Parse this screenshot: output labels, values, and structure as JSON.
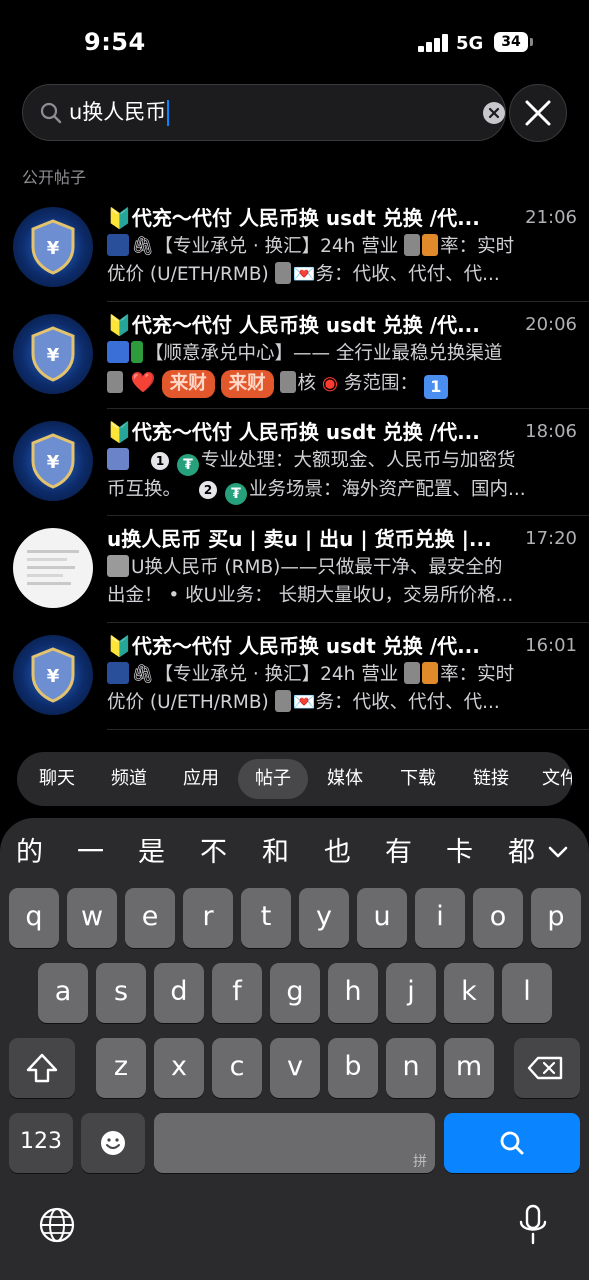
{
  "status_bar": {
    "time": "9:54",
    "network": "5G",
    "battery": "34"
  },
  "search": {
    "query": "u换人民币"
  },
  "section_label": "公开帖子",
  "results": [
    {
      "avatar": "shield-logo",
      "title": "🔰代充～代付 人民币换 usdt 兑换 /代...",
      "time": "21:06",
      "line1": "🖇【专业承兑 · 换汇】24h 营业 ",
      "line1b": "率：实时",
      "line2": "优价 (U/ETH/RMB) ",
      "line2b": "💌务：代收、代付、代..."
    },
    {
      "avatar": "shield-logo",
      "title": "🔰代充～代付 人民币换 usdt 兑换 /代...",
      "time": "20:06",
      "line1": "【顺意承兑中心】—— 全行业最稳兑换渠道",
      "line2a": "❤️",
      "red1": "来财",
      "red2": "来财",
      "line2b": "核",
      "line2c": "务范围：",
      "badge": "1"
    },
    {
      "avatar": "shield-logo",
      "title": "🔰代充～代付 人民币换 usdt 兑换 /代...",
      "time": "18:06",
      "num1": "1",
      "line1": "专业处理：大额现金、人民币与加密货",
      "line2a": "币互换。",
      "num2": "2",
      "line2b": "业务场景：海外资产配置、国内..."
    },
    {
      "avatar": "document",
      "title": "u换人民币 买u | 卖u | 出u | 货币兑换 |...",
      "time": "17:20",
      "line1": "U换人民币 (RMB)——只做最干净、最安全的",
      "line2": "出金！ • 收U业务： 长期大量收U，交易所价格..."
    },
    {
      "avatar": "shield-logo",
      "title": "🔰代充～代付 人民币换 usdt 兑换 /代...",
      "time": "16:01",
      "line1": "🖇【专业承兑 · 换汇】24h 营业 ",
      "line1b": "率：实时",
      "line2": "优价 (U/ETH/RMB) ",
      "line2b": "💌务：代收、代付、代..."
    }
  ],
  "filter_tabs": [
    "聊天",
    "频道",
    "应用",
    "帖子",
    "媒体",
    "下载",
    "链接",
    "文件"
  ],
  "active_tab": "帖子",
  "keyboard": {
    "candidates": [
      "的",
      "一",
      "是",
      "不",
      "和",
      "也",
      "有",
      "卡",
      "都"
    ],
    "row1": [
      "q",
      "w",
      "e",
      "r",
      "t",
      "y",
      "u",
      "i",
      "o",
      "p"
    ],
    "row2": [
      "a",
      "s",
      "d",
      "f",
      "g",
      "h",
      "j",
      "k",
      "l"
    ],
    "row3": [
      "z",
      "x",
      "c",
      "v",
      "b",
      "n",
      "m"
    ],
    "numbers_key": "123",
    "space_hint": "拼",
    "colors": {
      "search_key": "#0a84ff",
      "key": "#6b6b6e",
      "dark_key": "#464649"
    }
  }
}
